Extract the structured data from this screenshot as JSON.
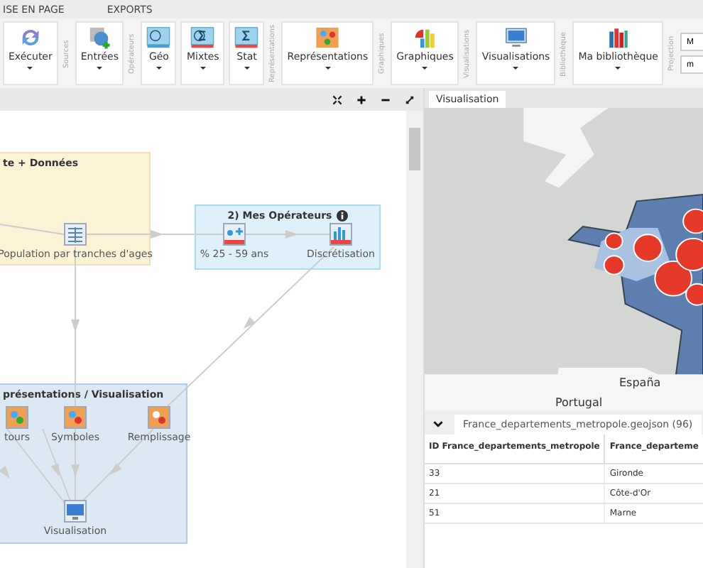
{
  "top_tabs": [
    {
      "label": "ISE EN PAGE",
      "selected": false
    },
    {
      "label": "EXPORTS",
      "selected": false
    }
  ],
  "ribbon": [
    {
      "buttons": [
        "Exécuter"
      ]
    },
    {
      "section": "Sources",
      "buttons": [
        "Entrées"
      ]
    },
    {
      "section": "Opérateurs",
      "buttons": [
        "Géo",
        "Mixtes",
        "Stat"
      ]
    },
    {
      "section": "Représentations",
      "buttons": [
        "Représentations"
      ]
    },
    {
      "section": "Graphiques",
      "buttons": [
        "Graphiques"
      ]
    },
    {
      "section": "Visualisations",
      "buttons": [
        "Visualisations"
      ]
    },
    {
      "section": "Bibliothèque",
      "buttons": [
        "Ma bibliothèque"
      ]
    },
    {
      "section": "Projection",
      "fields": [
        "M",
        "m"
      ]
    }
  ],
  "diagram": {
    "groups": [
      {
        "title": "te + Données",
        "kind": "data"
      },
      {
        "title": "2) Mes Opérateurs",
        "kind": "operators",
        "info": true
      },
      {
        "title": "présentations / Visualisation",
        "kind": "representations"
      }
    ],
    "nodes": [
      {
        "label": "Population par tranches d'ages",
        "kind": "table"
      },
      {
        "label": "% 25 - 59 ans",
        "kind": "operator"
      },
      {
        "label": "Discrétisation",
        "kind": "classes"
      },
      {
        "label": "tours",
        "kind": "layers"
      },
      {
        "label": "Symboles",
        "kind": "symbols"
      },
      {
        "label": "Remplissage",
        "kind": "fill"
      },
      {
        "label": "Visualisation",
        "kind": "screen"
      }
    ]
  },
  "visualisation_tab": {
    "label": "Visualisation",
    "selected": true
  },
  "map": {
    "labels": [
      "España",
      "Portugal"
    ]
  },
  "table": {
    "tab": "France_departements_metropole.geojson (96)",
    "columns": [
      "ID France_departements_metropole",
      "France_departeme"
    ],
    "rows": [
      [
        "33",
        "Gironde"
      ],
      [
        "21",
        "Côte-d'Or"
      ],
      [
        "51",
        "Marne"
      ]
    ]
  }
}
